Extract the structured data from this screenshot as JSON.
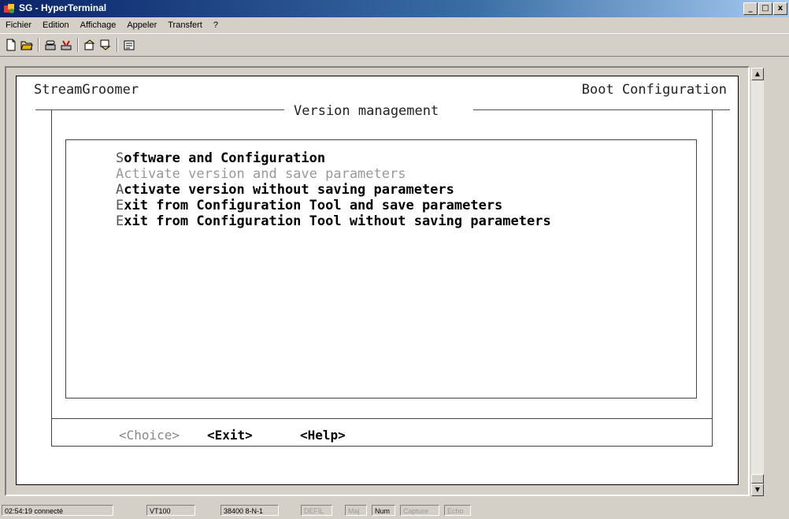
{
  "window": {
    "title": "SG - HyperTerminal",
    "minimize": "_",
    "maximize": "□",
    "close": "x"
  },
  "menubar": [
    "Fichier",
    "Edition",
    "Affichage",
    "Appeler",
    "Transfert",
    "?"
  ],
  "toolbar_icons": [
    "new-icon",
    "open-icon",
    "phone-icon",
    "disconnect-icon",
    "send-icon",
    "receive-icon",
    "properties-icon"
  ],
  "terminal": {
    "app_name": "StreamGroomer",
    "header_right": "Boot Configuration",
    "panel_title": "Version management",
    "menu_options": [
      {
        "hot": "S",
        "rest": "oftware and Configuration",
        "enabled": true
      },
      {
        "hot": "A",
        "rest": "ctivate version and save parameters",
        "enabled": false
      },
      {
        "hot": "A",
        "rest": "ctivate version without saving parameters",
        "enabled": true
      },
      {
        "hot": "E",
        "rest": "xit from Configuration Tool and save parameters",
        "enabled": true
      },
      {
        "hot": "E",
        "rest": "xit from Configuration Tool without saving parameters",
        "enabled": true
      }
    ],
    "buttons": {
      "choice": "<Choice>",
      "exit": "<Exit>",
      "help": "<Help>"
    }
  },
  "statusbar": {
    "connection": "02:54:19 connecté",
    "emulation": "VT100",
    "settings": "38400 8-N-1",
    "scroll": "DEFIL",
    "caps": "Maj",
    "num": "Num",
    "capture": "Capture",
    "echo": "Echo"
  },
  "colors": {
    "titlebar_start": "#0a246a",
    "titlebar_end": "#a6caf0",
    "terminal_bg": "#ffffff",
    "disabled_text": "#999999"
  }
}
